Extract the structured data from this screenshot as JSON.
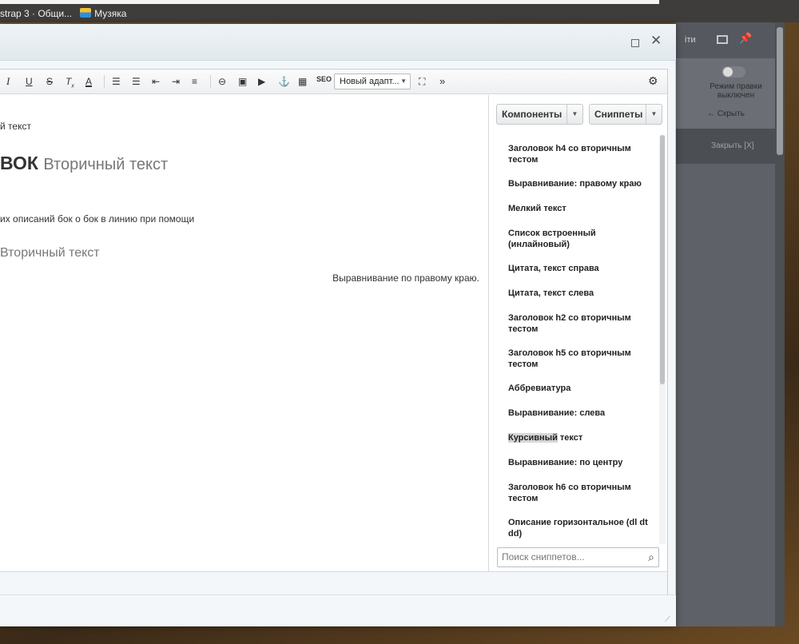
{
  "bookmarks": {
    "items": [
      {
        "label": "strap 3 · Общи..."
      },
      {
        "label": "Музяка"
      }
    ]
  },
  "background_panel": {
    "tab_label": "іти",
    "mode_label": "Режим правки выключен",
    "hide_label": "← Скрыть",
    "close_label": "Закрыть [X]"
  },
  "dialog": {
    "maximize_icon": "maximize-icon",
    "close_icon": "close-icon"
  },
  "toolbar": {
    "style_select_value": "Новый адапт...",
    "seo_label": "SEO",
    "more_label": "»"
  },
  "content": {
    "line1": "й текст",
    "heading_main": "ВОК",
    "heading_secondary": "Вторичный текст",
    "line2": "их описаний бок о бок в линию при помощи",
    "subheading": "Вторичный текст",
    "right_aligned": "Выравнивание по правому краю."
  },
  "side_panel": {
    "components_label": "Компоненты",
    "snippets_label": "Сниппеты",
    "snippets": [
      "Заголовок h4 со вторичным тестом",
      "Выравнивание: правому краю",
      "Мелкий текст",
      "Список встроенный (инлайновый)",
      "Цитата, текст справа",
      "Цитата, текст слева",
      "Заголовок h2 со вторичным тестом",
      "Заголовок h5 со вторичным тестом",
      "Аббревиатура",
      "Выравнивание: слева",
      "Курсивный текст",
      "Выравнивание: по центру",
      "Заголовок h6 со вторичным тестом",
      "Описание горизонтальное (dl dt dd)"
    ],
    "highlighted_snippet_part": "Курсивный",
    "highlighted_snippet_rest": " текст",
    "search_placeholder": "Поиск сниппетов..."
  }
}
